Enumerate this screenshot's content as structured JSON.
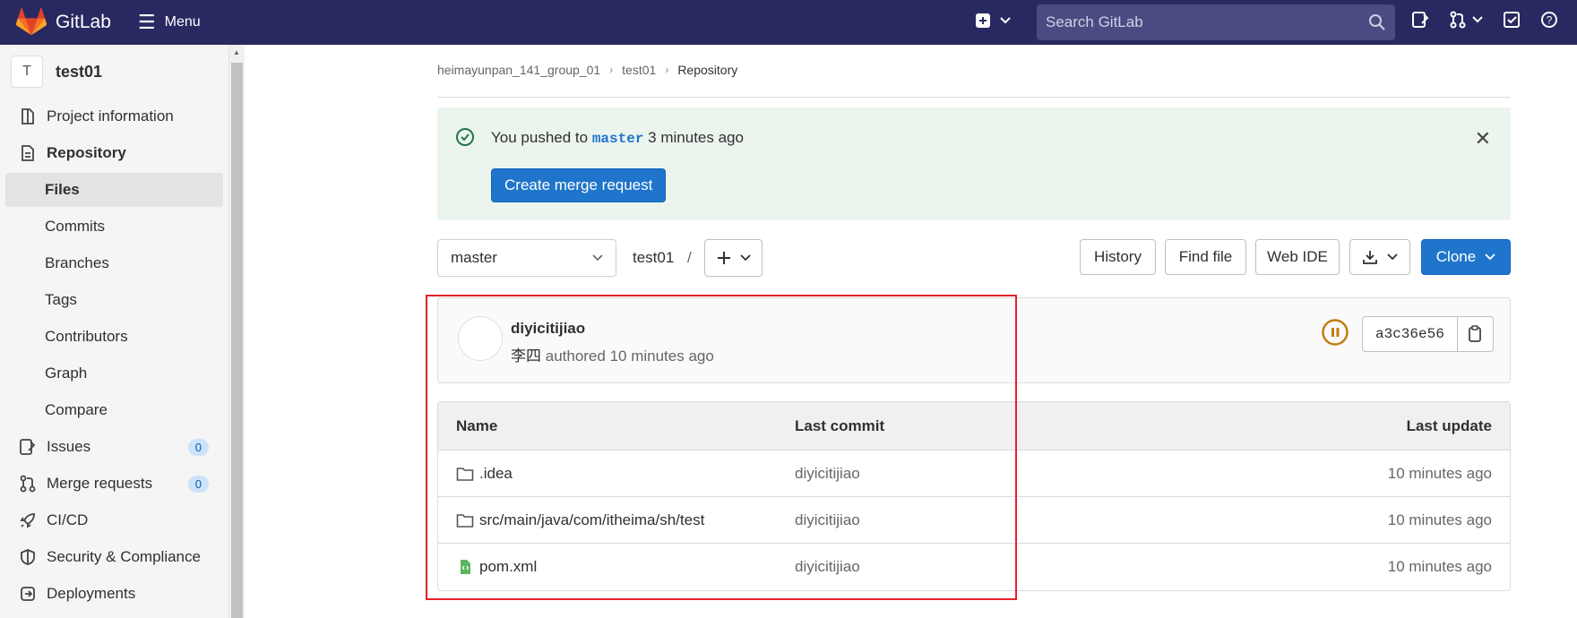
{
  "topbar": {
    "logo_text": "GitLab",
    "menu_label": "Menu",
    "search_placeholder": "Search GitLab",
    "bg_color": "#292961"
  },
  "sidebar": {
    "project_initial": "T",
    "project_name": "test01",
    "items": [
      {
        "label": "Project information",
        "icon": "info-icon"
      },
      {
        "label": "Repository",
        "icon": "document-icon"
      },
      {
        "label": "Files",
        "active": true
      },
      {
        "label": "Commits"
      },
      {
        "label": "Branches"
      },
      {
        "label": "Tags"
      },
      {
        "label": "Contributors"
      },
      {
        "label": "Graph"
      },
      {
        "label": "Compare"
      },
      {
        "label": "Issues",
        "icon": "issues-icon",
        "badge": "0"
      },
      {
        "label": "Merge requests",
        "icon": "merge-request-icon",
        "badge": "0"
      },
      {
        "label": "CI/CD",
        "icon": "rocket-icon"
      },
      {
        "label": "Security & Compliance",
        "icon": "shield-icon"
      },
      {
        "label": "Deployments",
        "icon": "deployments-icon"
      }
    ]
  },
  "breadcrumb": {
    "group": "heimayunpan_141_group_01",
    "project": "test01",
    "current": "Repository"
  },
  "alert": {
    "text_before": "You pushed to",
    "branch": "master",
    "text_after": "3 minutes ago",
    "button_label": "Create merge request",
    "bg_color": "#ecf4ee"
  },
  "toolbar": {
    "branch": "master",
    "path": "test01",
    "path_sep": "/",
    "history_label": "History",
    "find_file_label": "Find file",
    "web_ide_label": "Web IDE",
    "clone_label": "Clone",
    "accent": "#1f75cb"
  },
  "commit": {
    "title": "diyicitijiao",
    "author": "李四",
    "meta": "authored 10 minutes ago",
    "sha": "a3c36e56",
    "pipeline_color": "#c17d10"
  },
  "tree": {
    "headers": [
      "Name",
      "Last commit",
      "Last update"
    ],
    "rows": [
      {
        "name": ".idea",
        "type": "folder",
        "commit": "diyicitijiao",
        "updated": "10 minutes ago"
      },
      {
        "name": "src/main/java/com/itheima/sh/test",
        "type": "folder",
        "commit": "diyicitijiao",
        "updated": "10 minutes ago"
      },
      {
        "name": "pom.xml",
        "type": "file",
        "commit": "diyicitijiao",
        "updated": "10 minutes ago"
      }
    ]
  },
  "annotation": {
    "highlight_color": "#e8202a"
  }
}
